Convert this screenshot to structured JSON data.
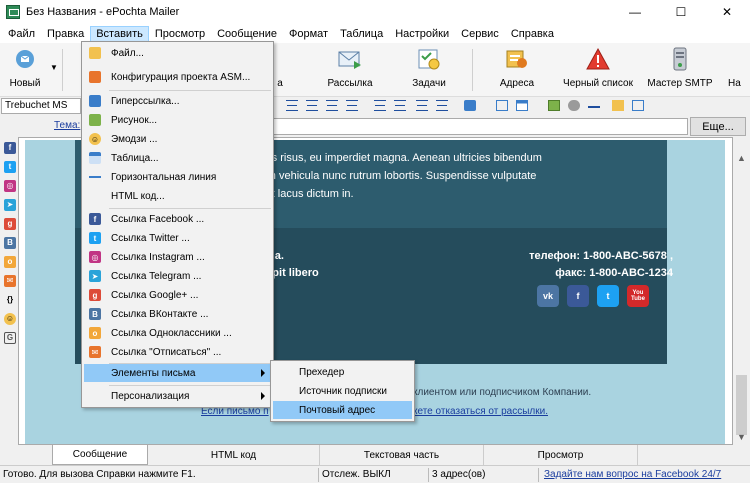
{
  "window": {
    "title": "Без Названия - ePochta Mailer",
    "controls": [
      "—",
      "☐",
      "✕"
    ]
  },
  "menubar": [
    "Файл",
    "Правка",
    "Вставить",
    "Просмотр",
    "Сообщение",
    "Формат",
    "Таблица",
    "Настройки",
    "Сервис",
    "Справка"
  ],
  "toolbar": {
    "new_label": "Новый",
    "labels": [
      "а",
      "Рассылка",
      "Задачи",
      "Адреса",
      "Черный список",
      "Мастер SMTP",
      "На"
    ]
  },
  "format_bar": {
    "font": "Trebuchet MS"
  },
  "subject": {
    "label": "Тема:",
    "button": "Еще..."
  },
  "dropdown": {
    "items": [
      {
        "label": "Файл..."
      },
      {
        "label": "Конфигурация проекта ASM..."
      },
      {
        "label": "Гиперссылка..."
      },
      {
        "label": "Рисунок..."
      },
      {
        "label": "Эмодзи ..."
      },
      {
        "label": "Таблица..."
      },
      {
        "label": "Горизонтальная линия"
      },
      {
        "label": "HTML код..."
      },
      {
        "label": "Ссылка Facebook ..."
      },
      {
        "label": "Ссылка Twitter ..."
      },
      {
        "label": "Ссылка Instagram ..."
      },
      {
        "label": "Ссылка Telegram ..."
      },
      {
        "label": "Ссылка Google+ ..."
      },
      {
        "label": "Ссылка ВКонтакте ..."
      },
      {
        "label": "Ссылка Однoклассники ..."
      },
      {
        "label": "Ссылка \"Отписаться\" ..."
      },
      {
        "label": "Элементы письма"
      },
      {
        "label": "Персонализация"
      }
    ]
  },
  "submenu": {
    "items": [
      "Прехедер",
      "Источник подписки",
      "Почтовый адрес"
    ]
  },
  "email": {
    "line1": "stas risus, eu imperdiet magna. Aenean ultricies bibendum",
    "line2": "rem vehicula nunc rutrum lobortis. Suspendisse vulputate",
    "line3": "giat lacus dictum in.",
    "left1": "urna.",
    "left2": "scipit libero",
    "phone": "телефон: 1-800-ABC-5678 ,",
    "fax": "факс: 1-800-ABC-1234",
    "social": [
      "vk",
      "f",
      "t",
      "You Tube"
    ],
    "footer_text": "клиентом или подписчиком Компании.",
    "footer_link_left": "Если письмо п",
    "footer_link_right": "кете отказаться от рассылки."
  },
  "tabs": [
    "Сообщение",
    "HTML код",
    "Текстовая часть",
    "Просмотр"
  ],
  "status": {
    "help": "Готово. Для вызова Справки нажмите F1.",
    "tracking": "Отслеж. ВЫКЛ",
    "addresses": "3 адрес(ов)",
    "link": "Задайте нам вопрос на Facebook 24/7"
  },
  "colors": {
    "menu_highlight": "#91c9f7",
    "email_dark": "#2d5c6e",
    "email_bg": "#a9d3e0"
  }
}
